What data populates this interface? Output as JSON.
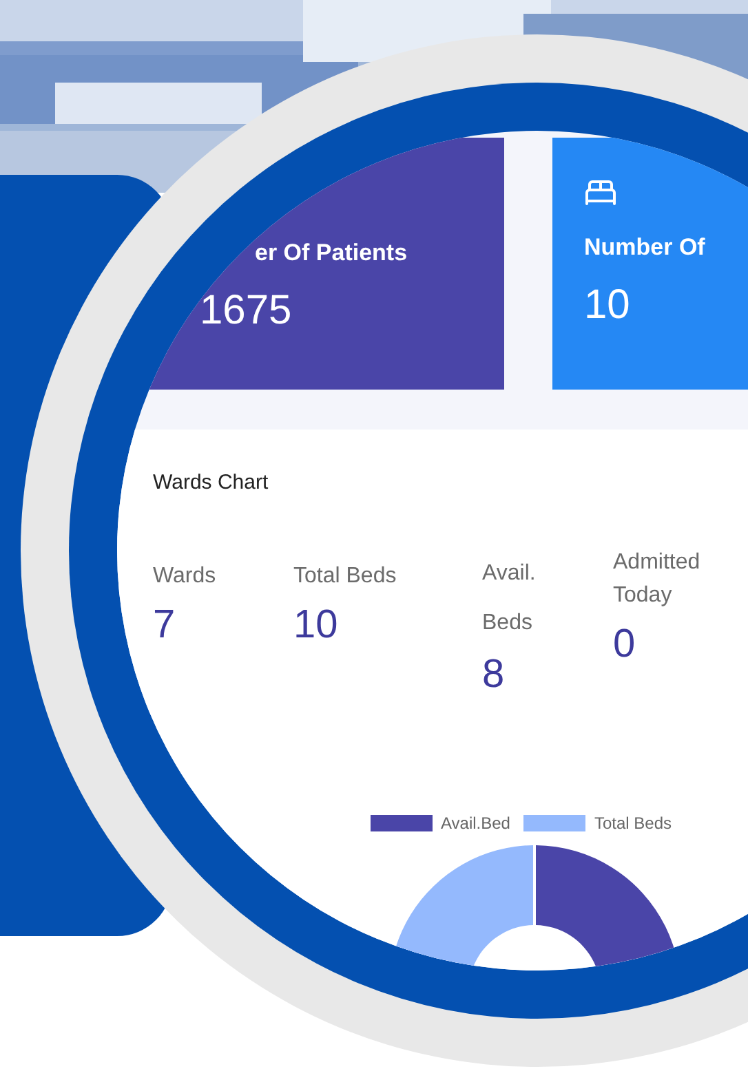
{
  "cards": [
    {
      "kind": "plain",
      "title": "er Of Patients",
      "value": "1675",
      "color": "#4a45a8"
    },
    {
      "kind": "bed",
      "title": "Number Of",
      "value": "10",
      "color": "#2588f4"
    }
  ],
  "wards_chart": {
    "title": "Wards Chart",
    "stats": [
      {
        "label": "Wards",
        "value": "7"
      },
      {
        "label": "Total Beds",
        "value": "10"
      },
      {
        "label": "Avail. Beds",
        "value": "8"
      },
      {
        "label": "Admitted Today",
        "value": "0"
      }
    ],
    "legend": [
      {
        "label": "Avail.Bed",
        "color": "#4a45a8"
      },
      {
        "label": "Total Beds",
        "color": "#94b9fd"
      }
    ]
  }
}
